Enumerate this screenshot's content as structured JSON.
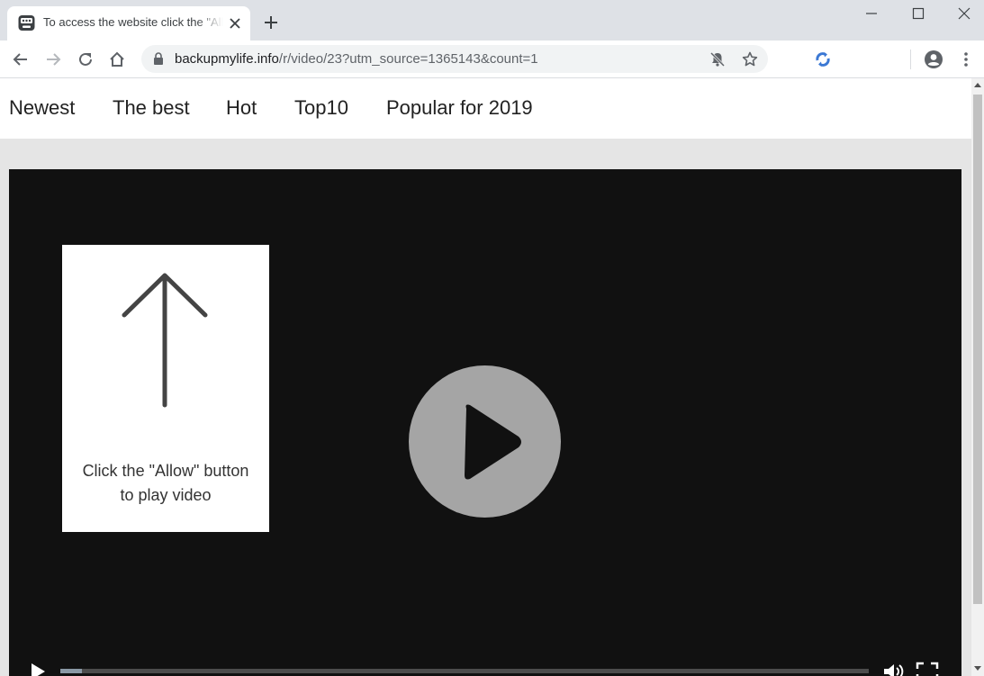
{
  "browser": {
    "tab": {
      "title": "To access the website click the \"Allow\" button",
      "favicon": "robot-icon"
    },
    "new_tab_icon": "plus-icon",
    "window_controls": [
      "minimize-icon",
      "maximize-icon",
      "close-icon"
    ],
    "address": {
      "host": "backupmylife.info",
      "path": "/r/video/23?utm_source=1365143&count=1"
    }
  },
  "nav": {
    "items": [
      {
        "label": "Newest"
      },
      {
        "label": "The best"
      },
      {
        "label": "Hot"
      },
      {
        "label": "Top10"
      },
      {
        "label": "Popular for 2019"
      }
    ]
  },
  "player": {
    "prompt_line1": "Click the \"Allow\" button",
    "prompt_line2": "to play video",
    "progress": 0.027
  },
  "colors": {
    "tabstrip": "#dee1e6",
    "player_bg": "#111111",
    "play_button": "#a5a5a5",
    "extension_icon": "#3b78d4"
  }
}
